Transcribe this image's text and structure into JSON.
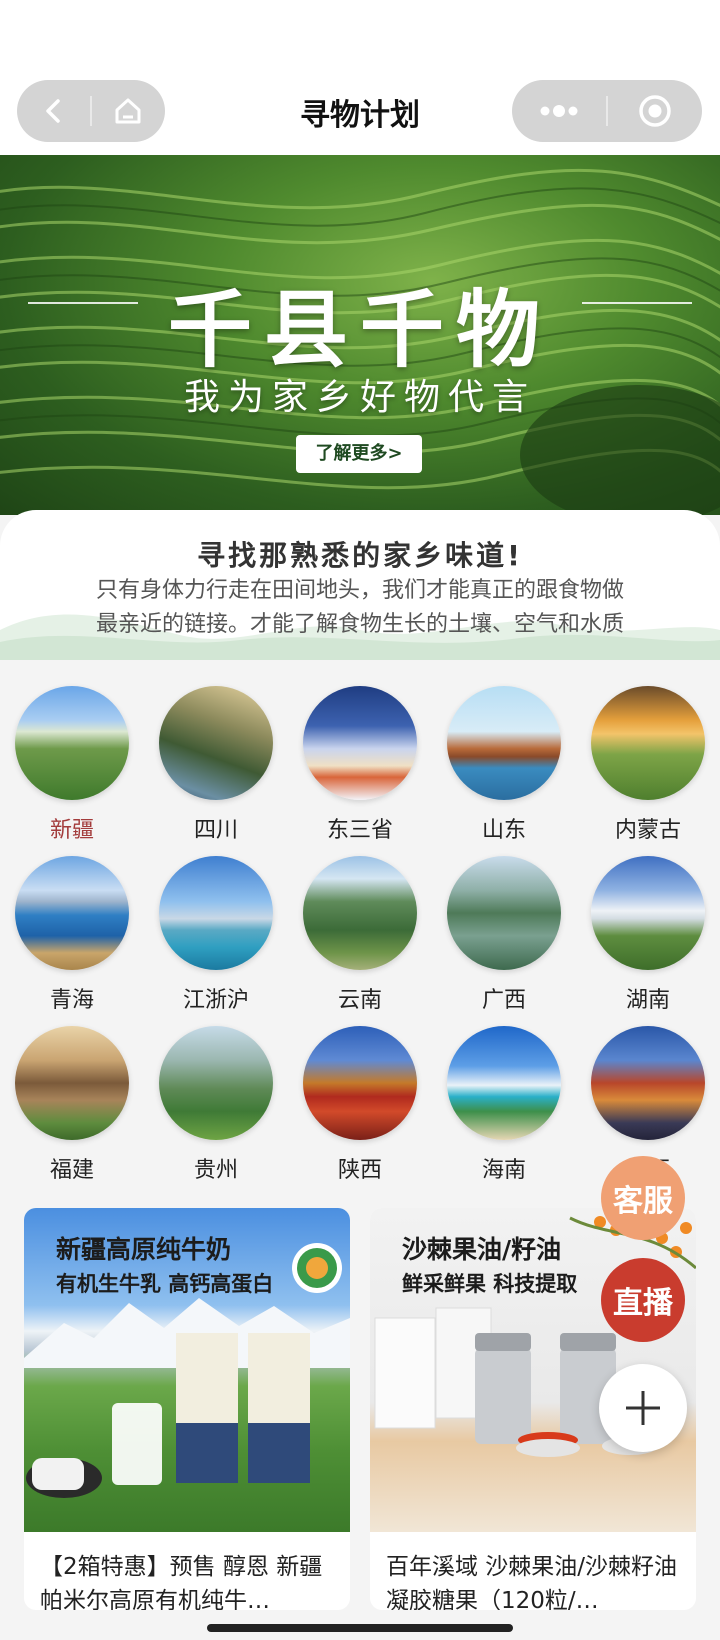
{
  "nav": {
    "title": "寻物计划",
    "back_icon": "chevron-left-icon",
    "home_icon": "home-icon",
    "more_icon": "more-dots-icon",
    "close_icon": "target-circle-icon"
  },
  "hero": {
    "title": "千县千物",
    "subtitle": "我为家乡好物代言",
    "button": "了解更多>"
  },
  "intro": {
    "title": "寻找那熟悉的家乡味道!",
    "line1": "只有身体力行走在田间地头，我们才能真正的跟食物做",
    "line2": "最亲近的链接。才能了解食物生长的土壤、空气和水质"
  },
  "regions": [
    {
      "label": "新疆",
      "active": true
    },
    {
      "label": "四川"
    },
    {
      "label": "东三省"
    },
    {
      "label": "山东"
    },
    {
      "label": "内蒙古"
    },
    {
      "label": "青海"
    },
    {
      "label": "江浙沪"
    },
    {
      "label": "云南"
    },
    {
      "label": "广西"
    },
    {
      "label": "湖南"
    },
    {
      "label": "福建"
    },
    {
      "label": "贵州"
    },
    {
      "label": "陕西"
    },
    {
      "label": "海南"
    },
    {
      "label": "江西"
    }
  ],
  "float": {
    "service": "客服",
    "live": "直播",
    "plus_icon": "plus-icon"
  },
  "products": [
    {
      "banner_title": "新疆高原纯牛奶",
      "banner_sub": "有机生牛乳 高钙高蛋白",
      "name": "【2箱特惠】预售 醇恩 新疆帕米尔高原有机纯牛…"
    },
    {
      "banner_title": "沙棘果油/籽油",
      "banner_sub": "鲜采鲜果 科技提取",
      "name": "百年溪域 沙棘果油/沙棘籽油 凝胶糖果（120粒/…"
    }
  ],
  "colors": {
    "active_region": "#a33c3c",
    "service_btn": "#f0a073",
    "live_btn": "#c93c2e"
  }
}
